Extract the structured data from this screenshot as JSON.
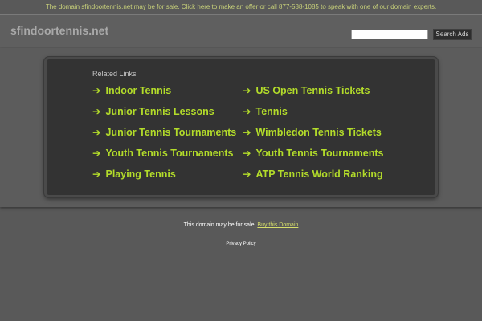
{
  "top_banner": {
    "text": "The domain sfindoortennis.net may be for sale. Click here to make an offer or call 877-588-1085 to speak with one of our domain experts."
  },
  "header": {
    "logo": "sfindoortennis.net",
    "search_placeholder": "",
    "search_button": "Search Ads"
  },
  "related": {
    "title": "Related Links",
    "links": [
      "Indoor Tennis",
      "US Open Tennis Tickets",
      "Junior Tennis Lessons",
      "Tennis",
      "Junior Tennis Tournaments",
      "Wimbledon Tennis Tickets",
      "Youth Tennis Tournaments",
      "Youth Tennis Tournaments",
      "Playing Tennis",
      "ATP Tennis World Ranking"
    ],
    "arrow": "➔"
  },
  "footer": {
    "sale_text": "This domain may be for sale.",
    "buy_link": "Buy this Domain",
    "privacy": "Privacy Policy"
  },
  "colors": {
    "background": "#595959",
    "panel": "#333333",
    "link": "#b3dc2a",
    "banner_text": "#c9d27a"
  }
}
